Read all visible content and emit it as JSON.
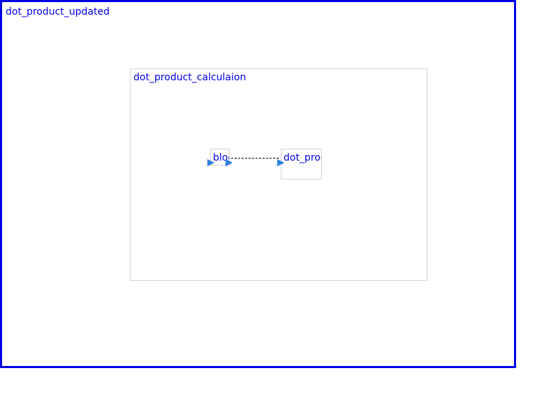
{
  "diagram": {
    "outer_block": {
      "title": "dot_product_updated",
      "border_color": "#0000e6"
    },
    "inner_block": {
      "title": "dot_product_calculaion",
      "border_color": "#d4d4d4"
    },
    "blocks": [
      {
        "label": "bloc"
      },
      {
        "label": "dot_proc"
      }
    ],
    "ports": {
      "color": "#2f7fd8",
      "icon": "triangle-port-icon"
    },
    "connection": {
      "style": "dashed",
      "color": "#000000"
    }
  }
}
